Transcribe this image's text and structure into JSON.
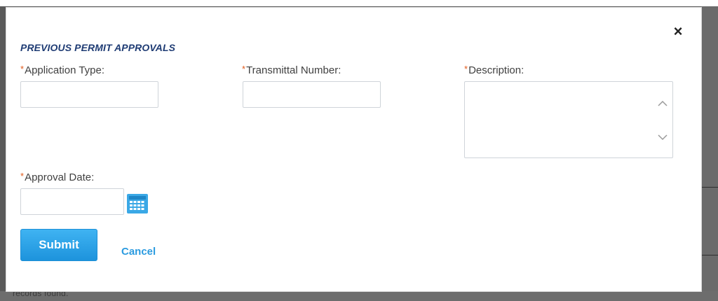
{
  "modal": {
    "section_title": "PREVIOUS PERMIT APPROVALS",
    "close_symbol": "×",
    "required_marker": "*",
    "fields": {
      "application_type": {
        "label": "Application Type:",
        "value": ""
      },
      "transmittal_number": {
        "label": "Transmittal Number:",
        "value": ""
      },
      "description": {
        "label": "Description:",
        "value": ""
      },
      "approval_date": {
        "label": "Approval Date:",
        "value": ""
      }
    },
    "submit_label": "Submit",
    "cancel_label": "Cancel",
    "icons": {
      "close": "close-icon",
      "calendar": "calendar-icon",
      "scroll_up": "chevron-up-icon",
      "scroll_down": "chevron-down-icon"
    }
  },
  "background": {
    "footer_text": "records found."
  },
  "colors": {
    "title": "#1f3c74",
    "required": "#e15b1c",
    "primary_button": "#2aa4ea",
    "link": "#2b9be0",
    "calendar": "#3aa8e6"
  }
}
